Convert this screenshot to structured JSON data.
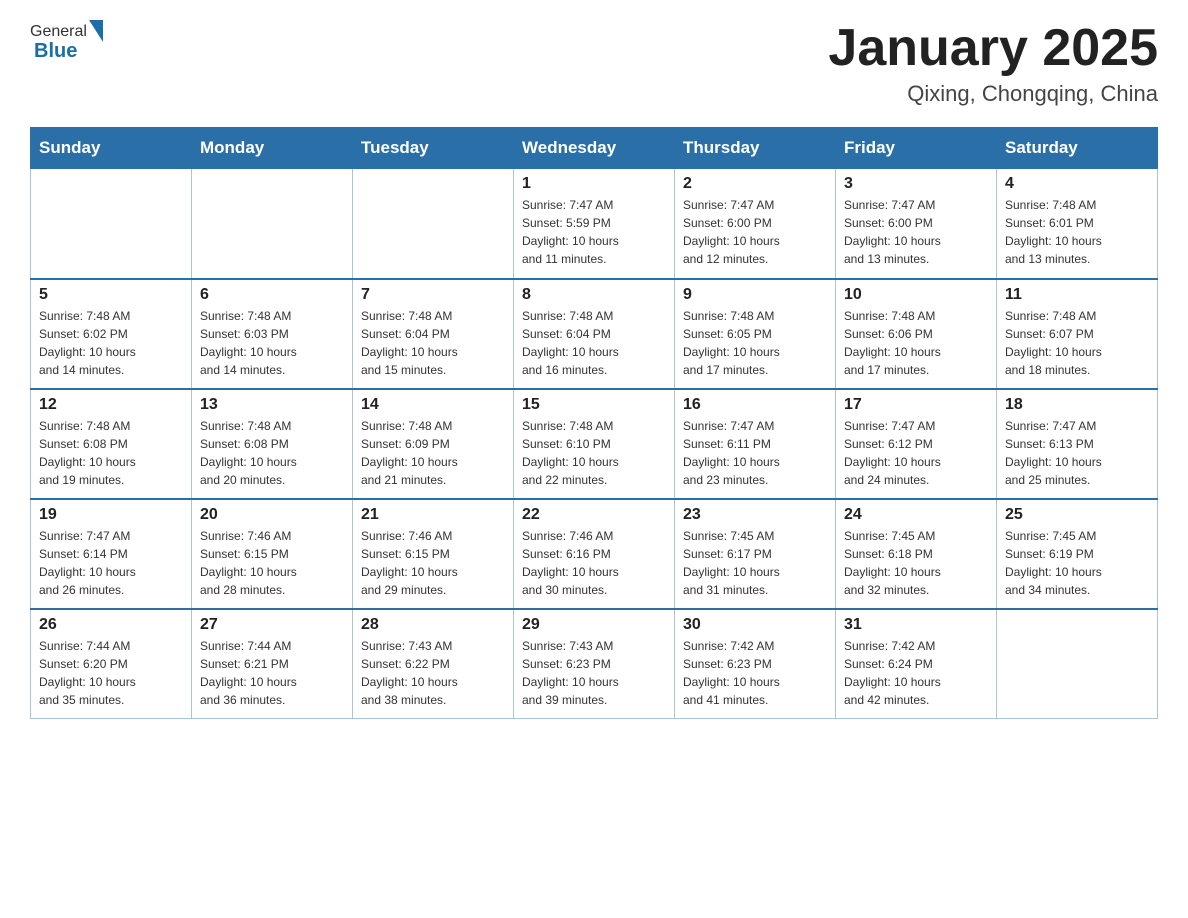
{
  "header": {
    "logo_general": "General",
    "logo_blue": "Blue",
    "month_year": "January 2025",
    "location": "Qixing, Chongqing, China"
  },
  "calendar": {
    "days_of_week": [
      "Sunday",
      "Monday",
      "Tuesday",
      "Wednesday",
      "Thursday",
      "Friday",
      "Saturday"
    ],
    "weeks": [
      [
        {
          "day": "",
          "info": ""
        },
        {
          "day": "",
          "info": ""
        },
        {
          "day": "",
          "info": ""
        },
        {
          "day": "1",
          "info": "Sunrise: 7:47 AM\nSunset: 5:59 PM\nDaylight: 10 hours\nand 11 minutes."
        },
        {
          "day": "2",
          "info": "Sunrise: 7:47 AM\nSunset: 6:00 PM\nDaylight: 10 hours\nand 12 minutes."
        },
        {
          "day": "3",
          "info": "Sunrise: 7:47 AM\nSunset: 6:00 PM\nDaylight: 10 hours\nand 13 minutes."
        },
        {
          "day": "4",
          "info": "Sunrise: 7:48 AM\nSunset: 6:01 PM\nDaylight: 10 hours\nand 13 minutes."
        }
      ],
      [
        {
          "day": "5",
          "info": "Sunrise: 7:48 AM\nSunset: 6:02 PM\nDaylight: 10 hours\nand 14 minutes."
        },
        {
          "day": "6",
          "info": "Sunrise: 7:48 AM\nSunset: 6:03 PM\nDaylight: 10 hours\nand 14 minutes."
        },
        {
          "day": "7",
          "info": "Sunrise: 7:48 AM\nSunset: 6:04 PM\nDaylight: 10 hours\nand 15 minutes."
        },
        {
          "day": "8",
          "info": "Sunrise: 7:48 AM\nSunset: 6:04 PM\nDaylight: 10 hours\nand 16 minutes."
        },
        {
          "day": "9",
          "info": "Sunrise: 7:48 AM\nSunset: 6:05 PM\nDaylight: 10 hours\nand 17 minutes."
        },
        {
          "day": "10",
          "info": "Sunrise: 7:48 AM\nSunset: 6:06 PM\nDaylight: 10 hours\nand 17 minutes."
        },
        {
          "day": "11",
          "info": "Sunrise: 7:48 AM\nSunset: 6:07 PM\nDaylight: 10 hours\nand 18 minutes."
        }
      ],
      [
        {
          "day": "12",
          "info": "Sunrise: 7:48 AM\nSunset: 6:08 PM\nDaylight: 10 hours\nand 19 minutes."
        },
        {
          "day": "13",
          "info": "Sunrise: 7:48 AM\nSunset: 6:08 PM\nDaylight: 10 hours\nand 20 minutes."
        },
        {
          "day": "14",
          "info": "Sunrise: 7:48 AM\nSunset: 6:09 PM\nDaylight: 10 hours\nand 21 minutes."
        },
        {
          "day": "15",
          "info": "Sunrise: 7:48 AM\nSunset: 6:10 PM\nDaylight: 10 hours\nand 22 minutes."
        },
        {
          "day": "16",
          "info": "Sunrise: 7:47 AM\nSunset: 6:11 PM\nDaylight: 10 hours\nand 23 minutes."
        },
        {
          "day": "17",
          "info": "Sunrise: 7:47 AM\nSunset: 6:12 PM\nDaylight: 10 hours\nand 24 minutes."
        },
        {
          "day": "18",
          "info": "Sunrise: 7:47 AM\nSunset: 6:13 PM\nDaylight: 10 hours\nand 25 minutes."
        }
      ],
      [
        {
          "day": "19",
          "info": "Sunrise: 7:47 AM\nSunset: 6:14 PM\nDaylight: 10 hours\nand 26 minutes."
        },
        {
          "day": "20",
          "info": "Sunrise: 7:46 AM\nSunset: 6:15 PM\nDaylight: 10 hours\nand 28 minutes."
        },
        {
          "day": "21",
          "info": "Sunrise: 7:46 AM\nSunset: 6:15 PM\nDaylight: 10 hours\nand 29 minutes."
        },
        {
          "day": "22",
          "info": "Sunrise: 7:46 AM\nSunset: 6:16 PM\nDaylight: 10 hours\nand 30 minutes."
        },
        {
          "day": "23",
          "info": "Sunrise: 7:45 AM\nSunset: 6:17 PM\nDaylight: 10 hours\nand 31 minutes."
        },
        {
          "day": "24",
          "info": "Sunrise: 7:45 AM\nSunset: 6:18 PM\nDaylight: 10 hours\nand 32 minutes."
        },
        {
          "day": "25",
          "info": "Sunrise: 7:45 AM\nSunset: 6:19 PM\nDaylight: 10 hours\nand 34 minutes."
        }
      ],
      [
        {
          "day": "26",
          "info": "Sunrise: 7:44 AM\nSunset: 6:20 PM\nDaylight: 10 hours\nand 35 minutes."
        },
        {
          "day": "27",
          "info": "Sunrise: 7:44 AM\nSunset: 6:21 PM\nDaylight: 10 hours\nand 36 minutes."
        },
        {
          "day": "28",
          "info": "Sunrise: 7:43 AM\nSunset: 6:22 PM\nDaylight: 10 hours\nand 38 minutes."
        },
        {
          "day": "29",
          "info": "Sunrise: 7:43 AM\nSunset: 6:23 PM\nDaylight: 10 hours\nand 39 minutes."
        },
        {
          "day": "30",
          "info": "Sunrise: 7:42 AM\nSunset: 6:23 PM\nDaylight: 10 hours\nand 41 minutes."
        },
        {
          "day": "31",
          "info": "Sunrise: 7:42 AM\nSunset: 6:24 PM\nDaylight: 10 hours\nand 42 minutes."
        },
        {
          "day": "",
          "info": ""
        }
      ]
    ]
  }
}
